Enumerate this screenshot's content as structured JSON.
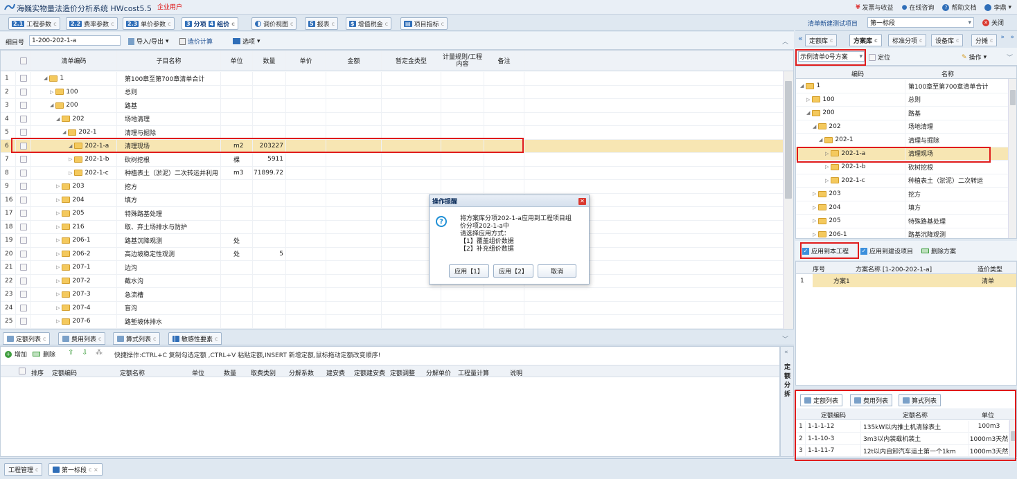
{
  "app": {
    "title": "海巍实物量法造价分析系统 HWcost5.5",
    "badge": "企业用户"
  },
  "topright": {
    "invoice": "发票与收益",
    "consult": "在线咨询",
    "help": "帮助文档",
    "user": "李鼎"
  },
  "main_tabs": [
    {
      "num": "2.1",
      "label": "工程参数"
    },
    {
      "num": "2.2",
      "label": "费率参数"
    },
    {
      "num": "2.3",
      "label": "单价参数"
    },
    {
      "num": "3",
      "label": "分项"
    },
    {
      "num": "4",
      "label": "组价"
    },
    {
      "num": "",
      "label": "调价视图"
    },
    {
      "num": "5",
      "label": "报表"
    },
    {
      "num": "",
      "label": "增值税金"
    },
    {
      "num": "",
      "label": "项目指标"
    }
  ],
  "right_header": {
    "project_label": "清单新建测试项目",
    "section": "第一标段",
    "close": "关闭"
  },
  "right_tabs": [
    "定额库",
    "方案库",
    "标准分项",
    "设备库",
    "分摊"
  ],
  "toolbar": {
    "label": "细目号",
    "value": "1-200-202-1-a",
    "import_export": "导入/导出",
    "calc": "造价计算",
    "options": "选项"
  },
  "columns": [
    "清单编码",
    "子目名称",
    "单位",
    "数量",
    "单价",
    "金额",
    "暂定金类型",
    "计量规则/工程内容",
    "备注"
  ],
  "rows": [
    {
      "n": "1",
      "code": "1",
      "name": "第100章至第700章清单合计",
      "unit": "",
      "qty": "",
      "level": 0,
      "open": true
    },
    {
      "n": "2",
      "code": "100",
      "name": "总则",
      "unit": "",
      "qty": "",
      "level": 1,
      "open": false
    },
    {
      "n": "3",
      "code": "200",
      "name": "路基",
      "unit": "",
      "qty": "",
      "level": 1,
      "open": true
    },
    {
      "n": "4",
      "code": "202",
      "name": "场地清理",
      "unit": "",
      "qty": "",
      "level": 2,
      "open": true
    },
    {
      "n": "5",
      "code": "202-1",
      "name": "清理与掘除",
      "unit": "",
      "qty": "",
      "level": 3,
      "open": true
    },
    {
      "n": "6",
      "code": "202-1-a",
      "name": "清理现场",
      "unit": "m2",
      "qty": "203227",
      "level": 4,
      "open": true
    },
    {
      "n": "7",
      "code": "202-1-b",
      "name": "砍树挖根",
      "unit": "棵",
      "qty": "5911",
      "level": 4,
      "open": false
    },
    {
      "n": "8",
      "code": "202-1-c",
      "name": "种植表土（淤泥）二次转运并利用",
      "unit": "m3",
      "qty": "71899.72",
      "level": 4,
      "open": false
    },
    {
      "n": "9",
      "code": "203",
      "name": "挖方",
      "unit": "",
      "qty": "",
      "level": 2,
      "open": false
    },
    {
      "n": "16",
      "code": "204",
      "name": "填方",
      "unit": "",
      "qty": "",
      "level": 2,
      "open": false
    },
    {
      "n": "17",
      "code": "205",
      "name": "特殊路基处理",
      "unit": "",
      "qty": "",
      "level": 2,
      "open": false
    },
    {
      "n": "18",
      "code": "216",
      "name": "取、弃土场排水与防护",
      "unit": "",
      "qty": "",
      "level": 2,
      "open": false
    },
    {
      "n": "19",
      "code": "206-1",
      "name": "路基沉降观测",
      "unit": "处",
      "qty": "",
      "level": 2,
      "open": false
    },
    {
      "n": "20",
      "code": "206-2",
      "name": "高边坡稳定性观测",
      "unit": "处",
      "qty": "5",
      "level": 2,
      "open": false
    },
    {
      "n": "21",
      "code": "207-1",
      "name": "边沟",
      "unit": "",
      "qty": "",
      "level": 2,
      "open": false
    },
    {
      "n": "22",
      "code": "207-2",
      "name": "截水沟",
      "unit": "",
      "qty": "",
      "level": 2,
      "open": false
    },
    {
      "n": "23",
      "code": "207-3",
      "name": "急流槽",
      "unit": "",
      "qty": "",
      "level": 2,
      "open": false
    },
    {
      "n": "24",
      "code": "207-4",
      "name": "盲沟",
      "unit": "",
      "qty": "",
      "level": 2,
      "open": false
    },
    {
      "n": "25",
      "code": "207-6",
      "name": "路堑坡体排水",
      "unit": "",
      "qty": "",
      "level": 2,
      "open": false
    }
  ],
  "dialog": {
    "title": "操作提醒",
    "lines": [
      "将方案库分项202-1-a应用到工程项目组",
      "价分项202-1-a中",
      "请选择应用方式：",
      "【1】覆盖组价数据",
      "【2】补充组价数据"
    ],
    "btn1": "应用【1】",
    "btn2": "应用【2】",
    "cancel": "取消"
  },
  "bottom_tabs": [
    "定额列表",
    "费用列表",
    "算式列表",
    "敏感性要素"
  ],
  "bottom_toolbar": {
    "add": "增加",
    "del": "删除",
    "hint": "快捷操作:CTRL+C 复制勾选定额 ,CTRL+V 粘贴定额,INSERT 新增定额,鼠标拖动定额改变顺序!"
  },
  "bottom_columns": [
    "排序",
    "定额编码",
    "定额名称",
    "单位",
    "数量",
    "取费类别",
    "分解系数",
    "建安费",
    "定额建安费",
    "定额调整",
    "分解单价",
    "工程量计算",
    "说明"
  ],
  "side_vertical": [
    "定",
    "额",
    "分",
    "拆"
  ],
  "footer_tabs": [
    "工程管理",
    "第一标段"
  ],
  "right_panel": {
    "select_value": "示例清单0号方案",
    "locate": "定位",
    "operate": "操作",
    "col_code": "编码",
    "col_name": "名称",
    "tree": [
      {
        "code": "1",
        "name": "第100章至第700章清单合计",
        "level": 0,
        "open": true
      },
      {
        "code": "100",
        "name": "总则",
        "level": 1,
        "open": false
      },
      {
        "code": "200",
        "name": "路基",
        "level": 1,
        "open": true
      },
      {
        "code": "202",
        "name": "场地清理",
        "level": 2,
        "open": true
      },
      {
        "code": "202-1",
        "name": "清理与掘除",
        "level": 3,
        "open": true
      },
      {
        "code": "202-1-a",
        "name": "清理现场",
        "level": 4,
        "open": false
      },
      {
        "code": "202-1-b",
        "name": "砍树挖根",
        "level": 4,
        "open": false
      },
      {
        "code": "202-1-c",
        "name": "种植表土（淤泥）二次转运",
        "level": 4,
        "open": false
      },
      {
        "code": "203",
        "name": "挖方",
        "level": 2,
        "open": false
      },
      {
        "code": "204",
        "name": "填方",
        "level": 2,
        "open": false
      },
      {
        "code": "205",
        "name": "特殊路基处理",
        "level": 2,
        "open": false
      },
      {
        "code": "206-1",
        "name": "路基沉降观测",
        "level": 2,
        "open": false
      }
    ],
    "apply_this": "应用到本工程",
    "apply_build": "应用到建设项目",
    "delete_plan": "删除方案",
    "plan_cols": [
      "序号",
      "方案名称 [1-200-202-1-a]",
      "造价类型"
    ],
    "plans": [
      {
        "n": "1",
        "name": "方案1",
        "type": "清单"
      }
    ],
    "sub_tabs": [
      "定额列表",
      "费用列表",
      "算式列表"
    ],
    "quota_cols": [
      "定额编码",
      "定额名称",
      "单位"
    ],
    "quotas": [
      {
        "n": "1",
        "code": "1-1-1-12",
        "name": "135kW以内推土机清除表土",
        "unit": "100m3"
      },
      {
        "n": "2",
        "code": "1-1-10-3",
        "name": "3m3以内装载机装土",
        "unit": "1000m3天然"
      },
      {
        "n": "3",
        "code": "1-1-11-7",
        "name": "12t以内自卸汽车运土第一个1km",
        "unit": "1000m3天然"
      }
    ]
  }
}
